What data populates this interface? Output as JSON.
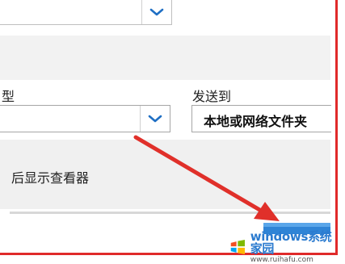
{
  "form": {
    "left_label": "型",
    "send_to_label": "发送到",
    "send_to_value": "本地或网络文件夹",
    "checkbox_label": "后显示查看器"
  },
  "colors": {
    "frame_border": "#e02a2a",
    "arrow": "#e0302a",
    "accent_button": "#2f84d6",
    "chevron": "#1f6fc4"
  },
  "icons": [
    "chevron-down-icon",
    "red-arrow-annotation",
    "windows-logo-icon"
  ],
  "watermark": {
    "brand": "windows系统家园",
    "domain": "www.ruihafu.com"
  }
}
